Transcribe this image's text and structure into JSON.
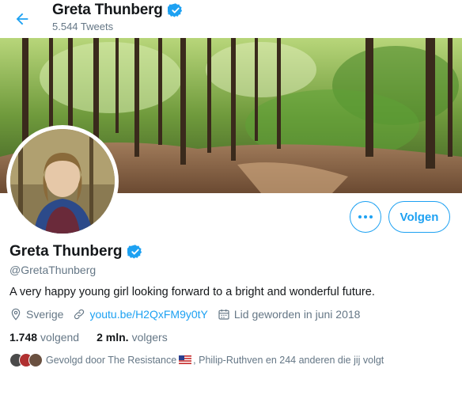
{
  "header": {
    "name": "Greta Thunberg",
    "tweet_count": "5.544 Tweets"
  },
  "profile": {
    "name": "Greta Thunberg",
    "handle": "@GretaThunberg",
    "bio": "A very happy young girl looking forward to a bright and wonderful future.",
    "location": "Sverige",
    "website": "youtu.be/H2QxFM9y0tY",
    "joined": "Lid geworden in juni 2018",
    "following_count": "1.748",
    "following_label": "volgend",
    "followers_count": "2 mln.",
    "followers_label": "volgers",
    "followed_by_prefix": "Gevolgd door The Resistance",
    "followed_by_suffix": ", Philip-Ruthven en 244 anderen die jij volgt"
  },
  "actions": {
    "follow_label": "Volgen",
    "more_icon": "more-dots-icon"
  },
  "icons": {
    "back": "arrow-left-icon",
    "verified": "verified-badge-icon",
    "location": "location-pin-icon",
    "link": "link-icon",
    "calendar": "calendar-icon",
    "flag": "us-flag-icon"
  },
  "colors": {
    "accent": "#1da1f2",
    "text": "#14171a",
    "secondary": "#657786"
  }
}
